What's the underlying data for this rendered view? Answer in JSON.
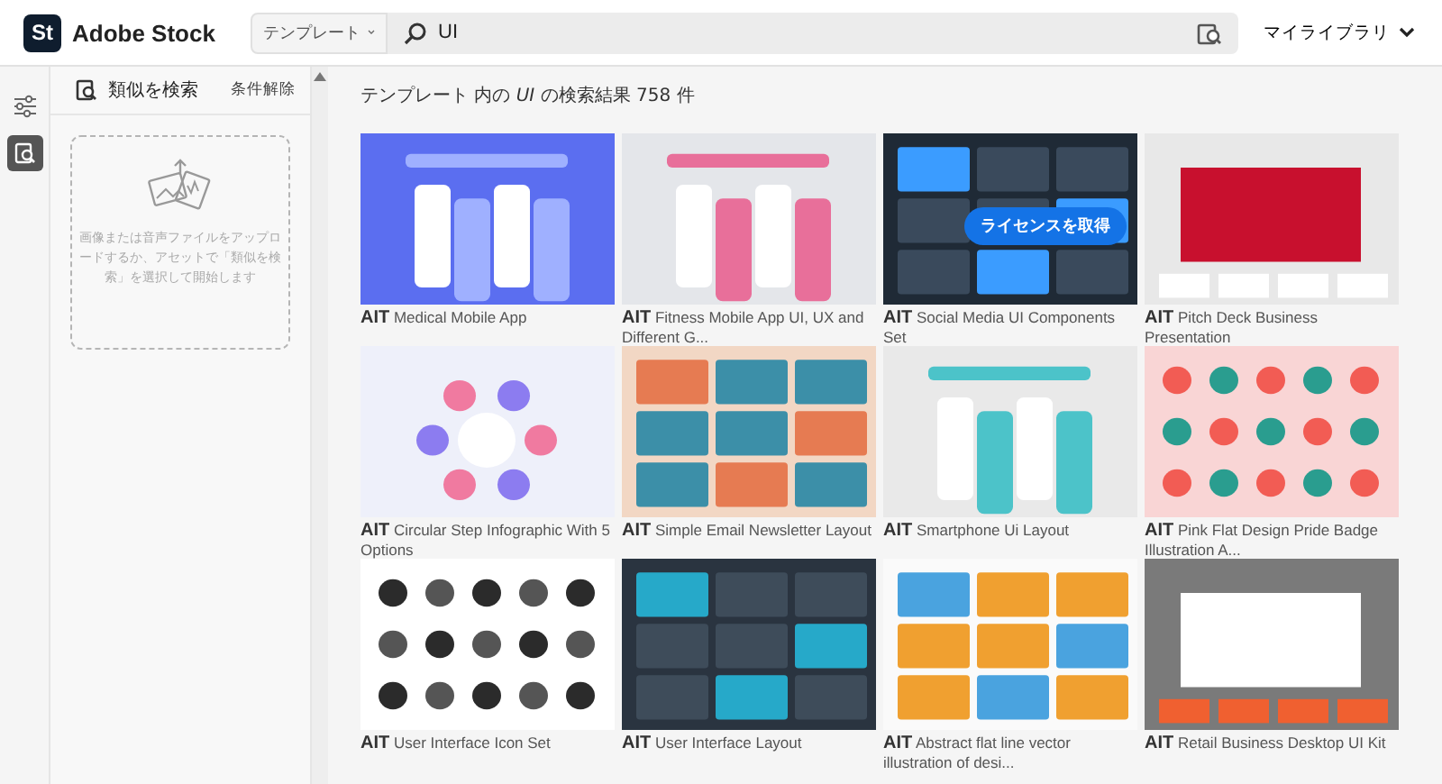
{
  "header": {
    "logo": "St",
    "brand": "Adobe Stock",
    "search": {
      "category": "テンプレート",
      "value": "UI"
    },
    "library": "マイライブラリ"
  },
  "sidebar": {
    "title": "類似を検索",
    "clear": "条件解除",
    "hint": "画像または音声ファイルをアップロードするか、アセットで「類似を検索」を選択して開始します"
  },
  "results": {
    "heading": "テンプレート 内の *UI* の検索結果 758 件",
    "items": [
      {
        "type": "AIT",
        "title": "Medical Mobile App",
        "kind": "picture"
      },
      {
        "type": "AIT",
        "title": "Fitness Mobile App UI, UX and Different G...",
        "kind": "picture"
      },
      {
        "type": "AIT",
        "title": "Social Media UI Components Set",
        "kind": "picture",
        "license_button": "ライセンスを取得"
      },
      {
        "type": "AIT",
        "title": "Pitch Deck Business Presentation",
        "kind": "picture"
      },
      {
        "type": "AIT",
        "title": "Circular Step Infographic With 5 Options",
        "kind": "picture"
      },
      {
        "type": "AIT",
        "title": "Simple Email Newsletter Layout",
        "kind": "picture"
      },
      {
        "type": "AIT",
        "title": "Smartphone Ui Layout",
        "kind": "picture"
      },
      {
        "type": "AIT",
        "title": "Pink Flat Design Pride Badge Illustration A...",
        "kind": "picture"
      },
      {
        "type": "AIT",
        "title": "User Interface Icon Set",
        "kind": "picture"
      },
      {
        "type": "AIT",
        "title": "User Interface Layout",
        "kind": "picture"
      },
      {
        "type": "AIT",
        "title": "Abstract flat line vector illustration of desi...",
        "kind": "picture"
      },
      {
        "type": "AIT",
        "title": "Retail Business Desktop UI Kit",
        "kind": "picture"
      }
    ]
  }
}
